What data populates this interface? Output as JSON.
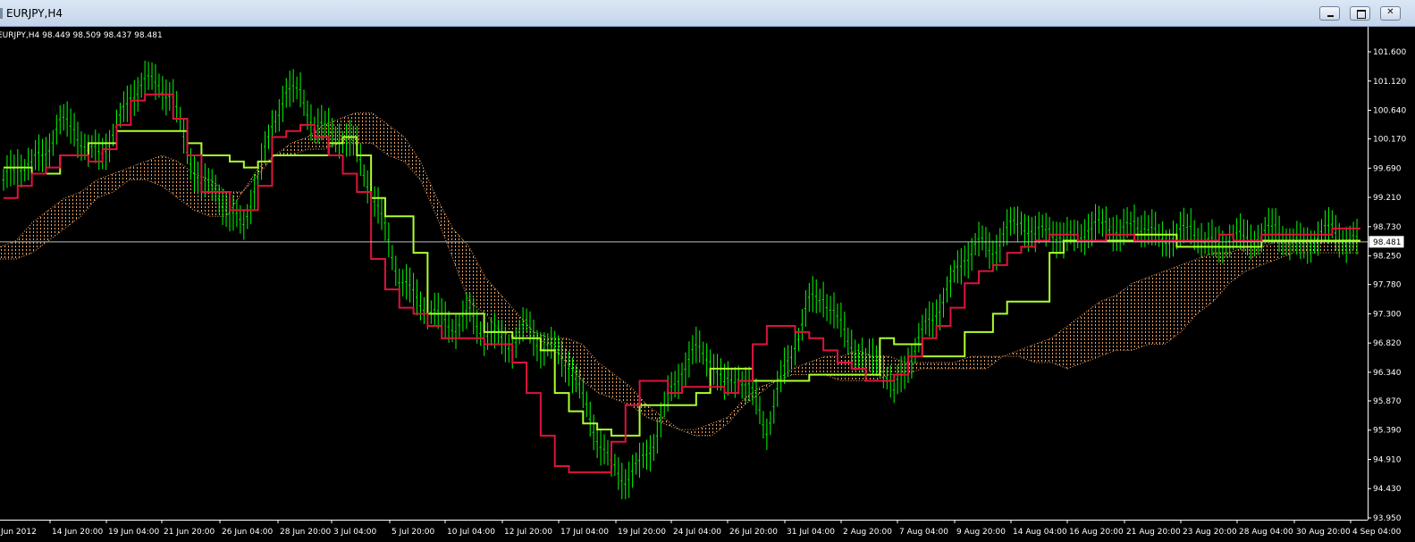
{
  "window": {
    "title": "EURJPY,H4"
  },
  "chart_data": {
    "type": "line",
    "symbol_info": "EURJPY,H4  98.449 98.509 98.437 98.481",
    "current_price": 98.481,
    "current_price_label": "98.481",
    "ylim": [
      93.95,
      101.8
    ],
    "y_ticks": [
      "101.600",
      "101.120",
      "100.640",
      "100.170",
      "99.690",
      "99.210",
      "98.730",
      "98.250",
      "97.780",
      "97.300",
      "96.820",
      "96.340",
      "95.870",
      "95.390",
      "94.910",
      "94.430",
      "93.950"
    ],
    "x_ticks": [
      "Jun 2012",
      "14 Jun 20:00",
      "19 Jun 04:00",
      "21 Jun 20:00",
      "26 Jun 04:00",
      "28 Jun 20:00",
      "3 Jul 04:00",
      "5 Jul 20:00",
      "10 Jul 04:00",
      "12 Jul 20:00",
      "17 Jul 04:00",
      "19 Jul 20:00",
      "24 Jul 04:00",
      "26 Jul 20:00",
      "31 Jul 04:00",
      "2 Aug 20:00",
      "7 Aug 04:00",
      "9 Aug 20:00",
      "14 Aug 04:00",
      "16 Aug 20:00",
      "21 Aug 20:00",
      "23 Aug 20:00",
      "28 Aug 04:00",
      "30 Aug 20:00",
      "4 Sep 04:00"
    ],
    "x_index": [
      0,
      4,
      8,
      12,
      16,
      20,
      24,
      28,
      32,
      36,
      40,
      44,
      48,
      52,
      56,
      60,
      64,
      68,
      72,
      76,
      80,
      84,
      88,
      92,
      96
    ],
    "grid": false,
    "colors": {
      "price": "#00ff00",
      "tenkan": "#dc143c",
      "kijun": "#adff2f",
      "cloud": "#f4a460",
      "axis": "#ffffff",
      "background": "#000000"
    },
    "series": [
      {
        "values": [
          99.5,
          99.7,
          99.8,
          99.9,
          100.5,
          100.3,
          100.0,
          99.9,
          100.4,
          100.8,
          101.2,
          101.0,
          100.9,
          99.9,
          99.5,
          99.3,
          99.0,
          98.7,
          99.6,
          100.3,
          101.0,
          100.9,
          100.4,
          100.3,
          100.2,
          100.0,
          99.3,
          98.7,
          97.9,
          97.6,
          97.4,
          97.2,
          97.1,
          97.3,
          97.0,
          96.9,
          96.8,
          97.1,
          96.8,
          96.7,
          96.5,
          95.9,
          95.3,
          94.8,
          94.6,
          94.8,
          95.2,
          95.9,
          96.4,
          96.7,
          96.6,
          96.1,
          96.3,
          96.0,
          95.4,
          96.2,
          96.8,
          97.5,
          97.6,
          97.2,
          96.8,
          96.5,
          96.6,
          96.0,
          96.5,
          97.0,
          97.3,
          97.8,
          98.2,
          98.5,
          98.3,
          98.7,
          98.8,
          98.6,
          98.7,
          98.5,
          98.6,
          98.7,
          98.8,
          98.6,
          98.8,
          98.7,
          98.5,
          98.6,
          98.7,
          98.5,
          98.4,
          98.6,
          98.5,
          98.6,
          98.7,
          98.5,
          98.4,
          98.6,
          98.7,
          98.5,
          98.48
        ]
      },
      {
        "values": [
          99.2,
          99.4,
          99.6,
          99.7,
          99.9,
          99.9,
          99.8,
          100.0,
          100.4,
          100.8,
          100.9,
          100.9,
          100.5,
          99.9,
          99.3,
          99.3,
          99.0,
          99.0,
          99.4,
          100.2,
          100.3,
          100.4,
          100.2,
          99.9,
          99.6,
          99.3,
          98.2,
          97.7,
          97.4,
          97.3,
          97.1,
          96.9,
          96.9,
          96.9,
          96.8,
          96.8,
          96.5,
          96.0,
          95.3,
          94.8,
          94.7,
          94.7,
          94.7,
          95.2,
          95.8,
          96.2,
          96.2,
          96.0,
          96.1,
          96.1,
          96.1,
          96.0,
          96.2,
          96.8,
          97.1,
          97.1,
          97.0,
          96.9,
          96.7,
          96.5,
          96.4,
          96.2,
          96.2,
          96.3,
          96.6,
          96.9,
          97.1,
          97.4,
          97.8,
          98.0,
          98.1,
          98.3,
          98.4,
          98.5,
          98.6,
          98.6,
          98.5,
          98.5,
          98.6,
          98.6,
          98.5,
          98.5,
          98.5,
          98.5,
          98.5,
          98.5,
          98.6,
          98.5,
          98.5,
          98.6,
          98.6,
          98.6,
          98.6,
          98.6,
          98.7,
          98.7,
          98.7
        ]
      },
      {
        "values": [
          99.7,
          99.7,
          99.6,
          99.6,
          99.9,
          99.9,
          100.1,
          100.1,
          100.3,
          100.3,
          100.3,
          100.3,
          100.3,
          100.1,
          99.9,
          99.9,
          99.8,
          99.7,
          99.8,
          99.9,
          99.9,
          99.9,
          99.9,
          100.1,
          100.2,
          99.9,
          99.2,
          98.9,
          98.9,
          98.3,
          97.3,
          97.3,
          97.3,
          97.3,
          97.0,
          97.0,
          96.9,
          96.9,
          96.7,
          96.0,
          95.7,
          95.5,
          95.4,
          95.3,
          95.3,
          95.8,
          95.8,
          95.8,
          95.8,
          96.0,
          96.4,
          96.4,
          96.4,
          96.2,
          96.2,
          96.2,
          96.2,
          96.3,
          96.3,
          96.3,
          96.3,
          96.3,
          96.9,
          96.8,
          96.8,
          96.6,
          96.6,
          96.6,
          97.0,
          97.0,
          97.3,
          97.5,
          97.5,
          97.5,
          98.3,
          98.5,
          98.5,
          98.5,
          98.5,
          98.5,
          98.6,
          98.6,
          98.6,
          98.4,
          98.4,
          98.4,
          98.4,
          98.4,
          98.4,
          98.5,
          98.5,
          98.5,
          98.5,
          98.5,
          98.5,
          98.5,
          98.5
        ]
      }
    ],
    "cloud": {
      "span_a": [
        98.4,
        98.5,
        98.8,
        99.0,
        99.2,
        99.3,
        99.5,
        99.6,
        99.7,
        99.8,
        99.9,
        99.8,
        99.6,
        99.5,
        99.3,
        99.3,
        99.6,
        99.9,
        100.1,
        100.2,
        100.4,
        100.5,
        100.6,
        100.6,
        100.4,
        100.2,
        99.8,
        99.2,
        98.7,
        98.4,
        97.9,
        97.6,
        97.3,
        97.0,
        96.8,
        96.5,
        96.2,
        96.0,
        95.9,
        95.8,
        95.6,
        95.5,
        95.4,
        95.4,
        95.5,
        95.6,
        95.8,
        96.0,
        96.2,
        96.4,
        96.5,
        96.6,
        96.6,
        96.7,
        96.6,
        96.6,
        96.5,
        96.5,
        96.5,
        96.4,
        96.4,
        96.4,
        96.6,
        96.7,
        96.8,
        96.9,
        97.1,
        97.3,
        97.5,
        97.6,
        97.8,
        97.9,
        98.0,
        98.1,
        98.2,
        98.3,
        98.3,
        98.4,
        98.4,
        98.5,
        98.5,
        98.5,
        98.5,
        98.5,
        98.5
      ],
      "span_b": [
        98.2,
        98.2,
        98.3,
        98.5,
        98.7,
        98.9,
        99.2,
        99.3,
        99.5,
        99.5,
        99.4,
        99.2,
        99.0,
        98.9,
        98.9,
        99.3,
        99.7,
        99.9,
        99.9,
        100.0,
        100.0,
        100.1,
        100.1,
        100.1,
        99.9,
        99.8,
        99.5,
        98.9,
        98.2,
        97.5,
        97.3,
        97.0,
        96.9,
        96.9,
        96.9,
        96.9,
        96.8,
        96.5,
        96.3,
        96.1,
        95.8,
        95.6,
        95.4,
        95.3,
        95.3,
        95.5,
        95.9,
        96.1,
        96.2,
        96.3,
        96.3,
        96.3,
        96.2,
        96.2,
        96.2,
        96.3,
        96.3,
        96.4,
        96.4,
        96.5,
        96.6,
        96.6,
        96.6,
        96.6,
        96.5,
        96.5,
        96.4,
        96.5,
        96.6,
        96.7,
        96.7,
        96.8,
        96.8,
        97.0,
        97.3,
        97.5,
        97.8,
        98.0,
        98.1,
        98.2,
        98.3,
        98.3,
        98.3,
        98.3,
        98.3
      ]
    }
  }
}
